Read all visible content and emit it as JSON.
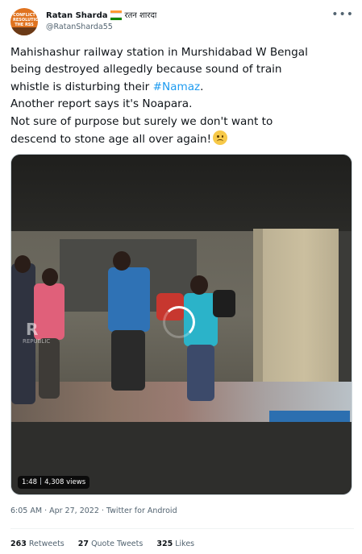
{
  "author": {
    "name": "Ratan Sharda",
    "name_hindi": "रतन शारदा",
    "handle": "@RatanSharda55",
    "avatar_text": "CONFLICT RESOLUTION THE RSS WAY"
  },
  "tweet": {
    "line1": "Mahishashur railway station in Murshidabad W Bengal",
    "line2_prefix": "being destroyed allegedly because sound of train",
    "line3_prefix": "whistle is disturbing their ",
    "hashtag": "#Namaz",
    "line3_suffix": ".",
    "line4": "Another report says it's Noapara.",
    "line5": "Not sure of purpose but surely we don't want to",
    "line6": "descend to stone age all over again!"
  },
  "media": {
    "duration": "1:48",
    "views": "4,308 views",
    "watermark": "R",
    "watermark_sub": "REPUBLIC"
  },
  "meta": {
    "timestamp": "6:05 AM · Apr 27, 2022 · Twitter for Android"
  },
  "stats": {
    "retweets_count": "263",
    "retweets_label": "Retweets",
    "quotes_count": "27",
    "quotes_label": "Quote Tweets",
    "likes_count": "325",
    "likes_label": "Likes"
  },
  "icons": {
    "more": "more-horizontal-icon",
    "flag": "india-flag-icon",
    "emoji": "slightly-frowning-face-icon",
    "spinner": "loading-spinner-icon"
  },
  "colors": {
    "link": "#1d9bf0",
    "secondary_text": "#536471",
    "primary_text": "#0f1419"
  }
}
